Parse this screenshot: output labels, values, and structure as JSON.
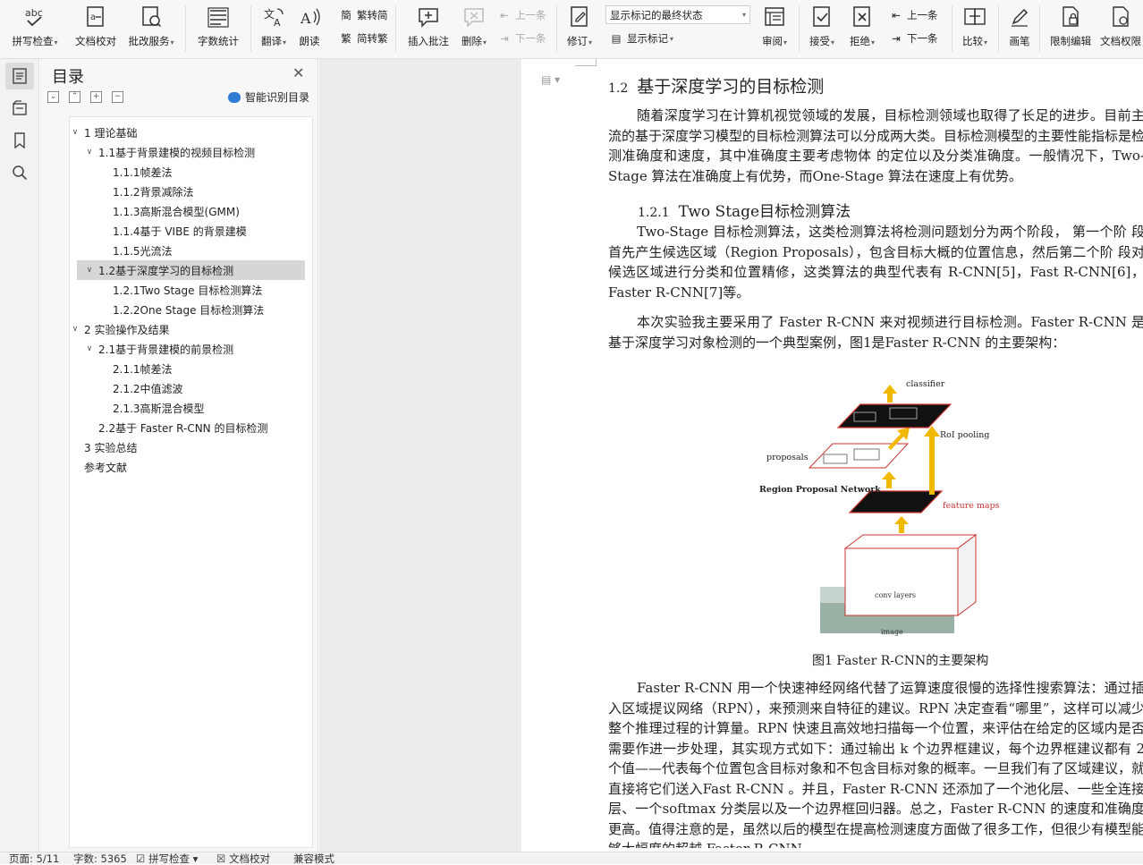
{
  "ribbon": {
    "spell_check": "拼写检查",
    "doc_proof": "文档校对",
    "review_service": "批改服务",
    "word_count": "字数统计",
    "translate": "翻译",
    "read_aloud": "朗读",
    "trad_to_simp": "繁转简",
    "simp_to_trad": "简转繁",
    "insert_comment": "插入批注",
    "delete": "删除",
    "prev_comment": "上一条",
    "next_comment": "下一条",
    "track_changes": "修订",
    "markup_mode": "显示标记的最终状态",
    "show_markup": "显示标记",
    "review": "审阅",
    "accept": "接受",
    "reject": "拒绝",
    "prev_change": "上一条",
    "next_change": "下一条",
    "compare": "比较",
    "ink": "画笔",
    "restrict_edit": "限制编辑",
    "doc_permission": "文档权限"
  },
  "toc": {
    "title": "目录",
    "smart_toc": "智能识别目录",
    "items": [
      {
        "label": "1 理论基础"
      },
      {
        "label": "1.1基于背景建模的视频目标检测"
      },
      {
        "label": "1.1.1帧差法"
      },
      {
        "label": "1.1.2背景减除法"
      },
      {
        "label": "1.1.3高斯混合模型(GMM)"
      },
      {
        "label": "1.1.4基于 VIBE 的背景建模"
      },
      {
        "label": "1.1.5光流法"
      },
      {
        "label": "1.2基于深度学习的目标检测"
      },
      {
        "label": "1.2.1Two Stage 目标检测算法"
      },
      {
        "label": "1.2.2One Stage 目标检测算法"
      },
      {
        "label": "2 实验操作及结果"
      },
      {
        "label": "2.1基于背景建模的前景检测"
      },
      {
        "label": "2.1.1帧差法"
      },
      {
        "label": "2.1.2中值滤波"
      },
      {
        "label": "2.1.3高斯混合模型"
      },
      {
        "label": "2.2基于 Faster R-CNN 的目标检测"
      },
      {
        "label": "3 实验总结"
      },
      {
        "label": "参考文献"
      }
    ]
  },
  "doc": {
    "h2_num": "1.2",
    "h2_text": "基于深度学习的目标检测",
    "p1": "随着深度学习在计算机视觉领域的发展，目标检测领域也取得了长足的进步。目前主流的基于深度学习模型的目标检测算法可以分成两大类。目标检测模型的主要性能指标是检测准确度和速度，其中准确度主要考虑物体 的定位以及分类准确度。一般情况下，Two-Stage 算法在准确度上有优势，而One-Stage 算法在速度上有优势。",
    "h3_num": "1.2.1",
    "h3_text": "Two Stage目标检测算法",
    "p2": "Two-Stage 目标检测算法，这类检测算法将检测问题划分为两个阶段， 第一个阶 段首先产生候选区域（Region Proposals），包含目标大概的位置信息，然后第二个阶 段对候选区域进行分类和位置精修，这类算法的典型代表有 R-CNN[5]，Fast R-CNN[6]，Faster R-CNN[7]等。",
    "p3": "本次实验我主要采用了 Faster R-CNN 来对视频进行目标检测。Faster R-CNN 是基于深度学习对象检测的一个典型案例，图1是Faster R-CNN 的主要架构：",
    "fig_labels": {
      "classifier": "classifier",
      "roi_pooling": "RoI pooling",
      "proposals": "proposals",
      "rpn": "Region Proposal Network",
      "feature_maps": "feature maps",
      "conv_layers": "conv layers",
      "image": "image"
    },
    "fig_caption": "图1 Faster R-CNN的主要架构",
    "p4": "Faster R-CNN 用一个快速神经网络代替了运算速度很慢的选择性搜索算法：通过插入区域提议网络（RPN），来预测来自特征的建议。RPN 决定查看“哪里”，这样可以减少整个推理过程的计算量。RPN 快速且高效地扫描每一个位置，来评估在给定的区域内是否需要作进一步处理，其实现方式如下：通过输出 k 个边界框建议，每个边界框建议都有 2 个值——代表每个位置包含目标对象和不包含目标对象的概率。一旦我们有了区域建议，就直接将它们送入Fast R-CNN 。并且，Faster R-CNN 还添加了一个池化层、一些全连接层、一个softmax 分类层以及一个边界框回归器。总之，Faster R-CNN 的速度和准确度更高。值得注意的是，虽然以后的模型在提高检测速度方面做了很多工作，但很少有模型能够大幅度的超越 Faster R-CNN。"
  },
  "status": {
    "page": "页面: 5/11",
    "words": "字数: 5365",
    "spell": "拼写检查",
    "proof": "文档校对",
    "compat": "兼容模式"
  }
}
